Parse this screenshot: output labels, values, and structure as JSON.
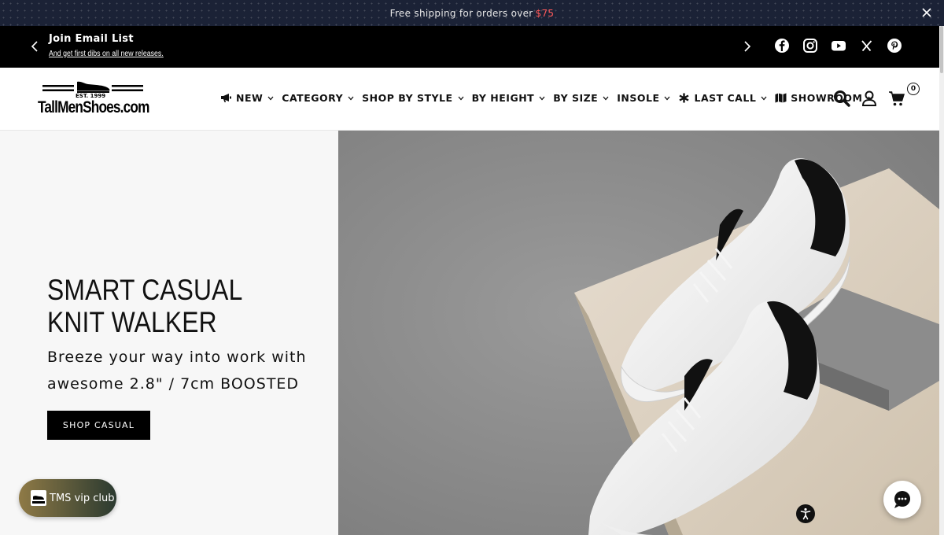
{
  "promo": {
    "text": "Free shipping for orders over",
    "price": "$75"
  },
  "email_bar": {
    "title": "Join Email List",
    "subtitle": "And get first dibs on all new releases."
  },
  "logo": {
    "est": "EST. 1999",
    "wordmark": "TallMenShoes.com"
  },
  "nav": {
    "items": [
      {
        "label": "NEW",
        "icon": "megaphone-icon",
        "has_dropdown": true
      },
      {
        "label": "CATEGORY",
        "icon": "",
        "has_dropdown": true
      },
      {
        "label": "SHOP BY STYLE",
        "icon": "",
        "has_dropdown": true
      },
      {
        "label": "BY HEIGHT",
        "icon": "",
        "has_dropdown": true
      },
      {
        "label": "BY SIZE",
        "icon": "",
        "has_dropdown": true
      },
      {
        "label": "INSOLE",
        "icon": "",
        "has_dropdown": true
      },
      {
        "label": "LAST CALL",
        "icon": "asterisk-icon",
        "has_dropdown": true
      },
      {
        "label": "SHOWROOM",
        "icon": "map-icon",
        "has_dropdown": true
      }
    ],
    "cart_count": "0"
  },
  "hero": {
    "title": "SMART CASUAL KNIT WALKER",
    "subtitle": "Breeze your way into work with awesome 2.8\" / 7cm BOOSTED",
    "cta": "SHOP CASUAL"
  },
  "vip": {
    "label": "TMS vip club"
  },
  "colors": {
    "promo_bg": "#1b2236",
    "price": "#ff5a5a",
    "bar": "#000000",
    "hero_left_bg": "#f7f7f7"
  }
}
